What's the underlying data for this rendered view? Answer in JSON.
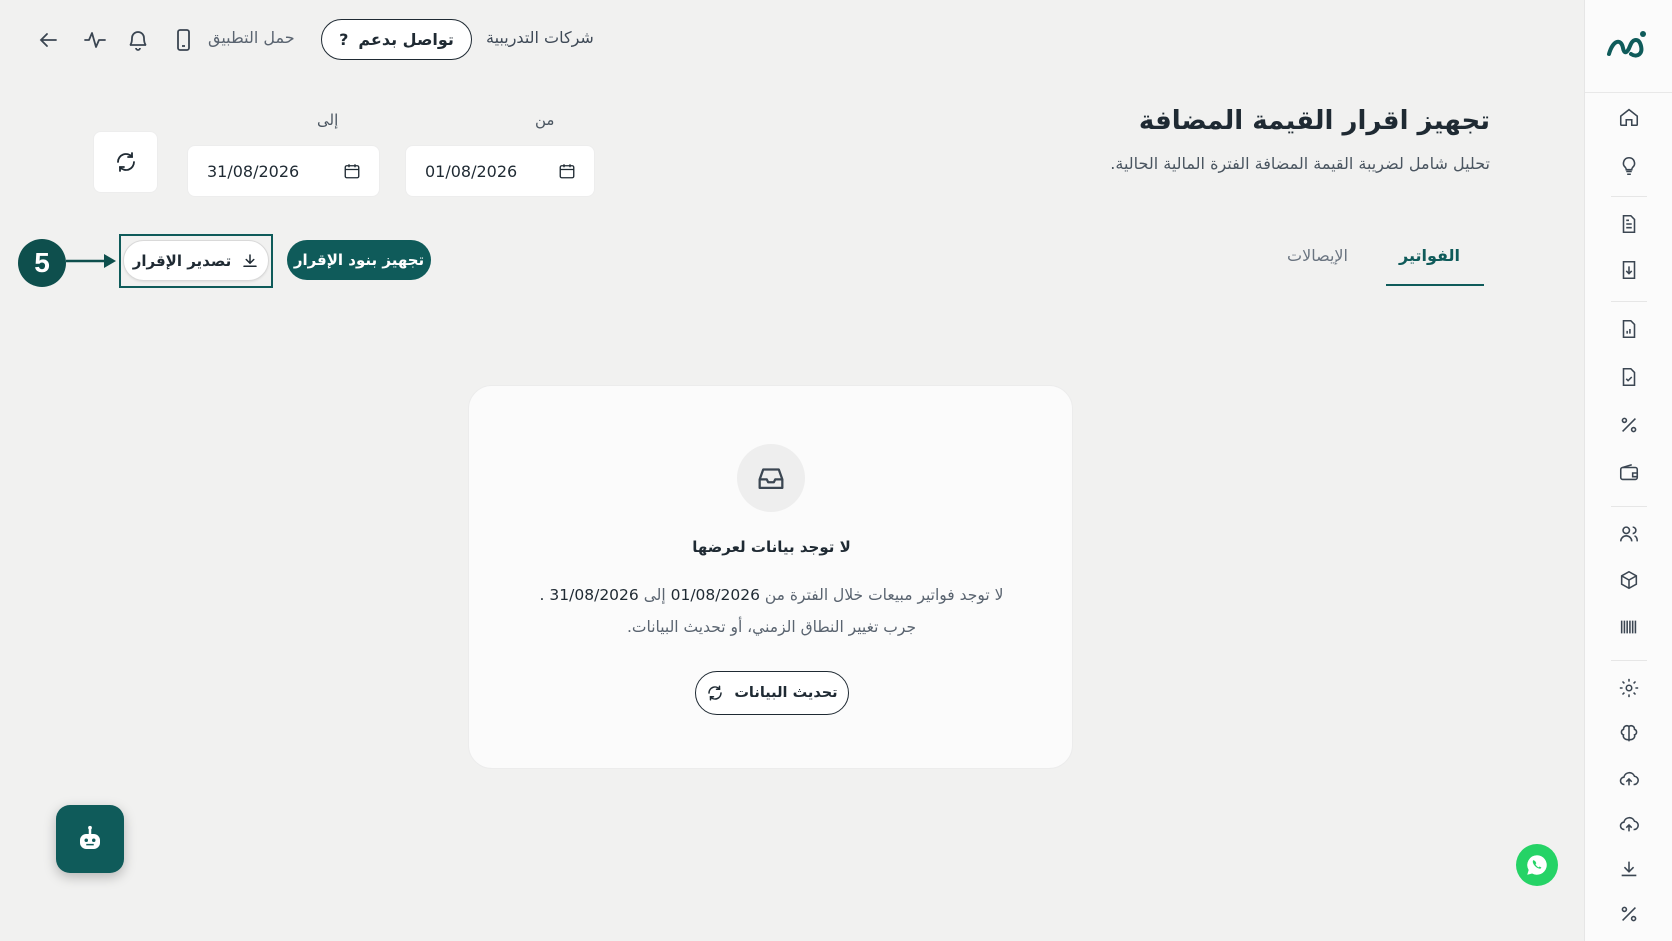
{
  "topbar": {
    "company_link": "شركات التدريبية",
    "support_label": "تواصل بدعم",
    "support_icon": "?",
    "app_link": "حمل التطبيق",
    "icons": [
      "back-arrow-icon",
      "activity-icon",
      "bell-icon",
      "phone-icon"
    ]
  },
  "header": {
    "title": "تجهيز اقرار القيمة المضافة",
    "subtitle": "تحليل شامل لضريبة القيمة المضافة الفترة المالية الحالية."
  },
  "filters": {
    "from_label": "من",
    "from_value": "01/08/2026",
    "to_label": "إلى",
    "to_value": "31/08/2026"
  },
  "tabs": [
    {
      "label": "الفواتير",
      "active": true
    },
    {
      "label": "الإيصالات",
      "active": false
    }
  ],
  "actions": {
    "prepare_label": "تجهيز بنود الإقرار",
    "export_label": "تصدير الإقرار",
    "step_number": "5"
  },
  "empty_state": {
    "title": "لا توجد بيانات لعرضها",
    "line1_prefix": "لا توجد فواتير مبيعات خلال الفترة من",
    "line1_from": "01/08/2026",
    "line1_mid": "إلى",
    "line1_to": "31/08/2026",
    "line1_suffix": ".",
    "line2": "جرب تغيير النطاق الزمني، أو تحديث البيانات.",
    "refresh_label": "تحديث البيانات"
  },
  "sidebar": {
    "icons": [
      "home-icon",
      "lightbulb-icon",
      "document-icon",
      "document-import-icon",
      "report-icon",
      "document-check-icon",
      "percent-icon",
      "wallet-icon",
      "users-icon",
      "box-icon",
      "barcode-icon",
      "gear-icon",
      "brain-icon",
      "cloud-upload-icon",
      "cloud-sync-icon",
      "download-icon",
      "percent-icon"
    ]
  },
  "colors": {
    "primary": "#0f5b5a",
    "background": "#f1f1f0",
    "whatsapp": "#25d366"
  }
}
